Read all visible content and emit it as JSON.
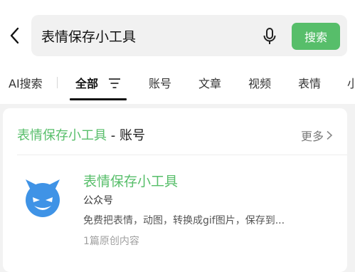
{
  "search": {
    "query": "表情保存小工具",
    "button_label": "搜索"
  },
  "tabs": [
    {
      "label": "AI搜索",
      "active": false
    },
    {
      "label": "全部",
      "active": true
    },
    {
      "label": "账号",
      "active": false
    },
    {
      "label": "文章",
      "active": false
    },
    {
      "label": "视频",
      "active": false
    },
    {
      "label": "表情",
      "active": false
    },
    {
      "label": "小",
      "active": false
    }
  ],
  "section": {
    "keyword": "表情保存小工具",
    "suffix": " - 账号",
    "more_label": "更多"
  },
  "account": {
    "name": "表情保存小工具",
    "type": "公众号",
    "description": "免费把表情，动图，转换成gif图片，保存到...",
    "articles": "1篇原创内容"
  },
  "colors": {
    "accent": "#57be6a",
    "avatar": "#3f93e6"
  },
  "icons": [
    "back-arrow-icon",
    "microphone-icon",
    "filter-icon",
    "chevron-right-icon",
    "devil-face-icon"
  ]
}
